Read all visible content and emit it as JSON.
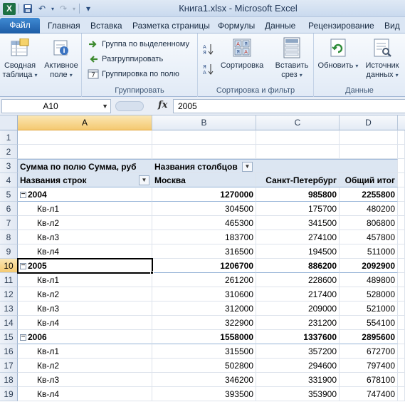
{
  "window": {
    "title": "Книга1.xlsx - Microsoft Excel",
    "logo_letter": "X"
  },
  "qat": {
    "icons": [
      "excel-logo",
      "save-icon",
      "undo-icon",
      "redo-icon",
      "customize-icon"
    ],
    "undo_glyph": "↶",
    "redo_glyph": "↷",
    "customize_glyph": "▾"
  },
  "tabs": {
    "file": "Файл",
    "items": [
      "Главная",
      "Вставка",
      "Разметка страницы",
      "Формулы",
      "Данные",
      "Рецензирование",
      "Вид"
    ],
    "active_index": null
  },
  "ribbon": {
    "pivot_table": {
      "line1": "Сводная",
      "line2": "таблица",
      "caret": "▾"
    },
    "active_field": {
      "line1": "Активное",
      "line2": "поле",
      "caret": "▾"
    },
    "group_selection": "Группа по выделенному",
    "ungroup": "Разгруппировать",
    "group_field": "Группировка по полю",
    "group_label_grouping": "Группировать",
    "sort_asc_label": "",
    "sort": "Сортировка",
    "insert_slicer": {
      "line1": "Вставить",
      "line2": "срез",
      "caret": "▾"
    },
    "group_label_sort": "Сортировка и фильтр",
    "refresh": {
      "line1": "Обновить",
      "caret": "▾"
    },
    "source": {
      "line1": "Источник",
      "line2": "данных",
      "caret": "▾"
    },
    "group_label_data": "Данные",
    "accent": "#2a6db8"
  },
  "formula_bar": {
    "name_box": "A10",
    "fx": "fx",
    "value": "2005"
  },
  "sheet": {
    "columns": [
      "A",
      "B",
      "C",
      "D"
    ],
    "selected_column": "A",
    "selected_row": "10",
    "pivot_header": {
      "sum_label": "Сумма по полю Сумма, руб",
      "col_labels": "Названия столбцов",
      "row_labels": "Названия строк",
      "moscow": "Москва",
      "spb": "Санкт-Петербург",
      "total": "Общий итог"
    },
    "rows": [
      {
        "n": "1",
        "a": "",
        "b": "",
        "c": "",
        "d": "",
        "type": "empty"
      },
      {
        "n": "2",
        "a": "",
        "b": "",
        "c": "",
        "d": "",
        "type": "empty"
      },
      {
        "n": "5",
        "a": "2004",
        "b": "1270000",
        "c": "985800",
        "d": "2255800",
        "type": "year"
      },
      {
        "n": "6",
        "a": "Кв-л1",
        "b": "304500",
        "c": "175700",
        "d": "480200",
        "type": "q"
      },
      {
        "n": "7",
        "a": "Кв-л2",
        "b": "465300",
        "c": "341500",
        "d": "806800",
        "type": "q"
      },
      {
        "n": "8",
        "a": "Кв-л3",
        "b": "183700",
        "c": "274100",
        "d": "457800",
        "type": "q"
      },
      {
        "n": "9",
        "a": "Кв-л4",
        "b": "316500",
        "c": "194500",
        "d": "511000",
        "type": "q"
      },
      {
        "n": "10",
        "a": "2005",
        "b": "1206700",
        "c": "886200",
        "d": "2092900",
        "type": "year"
      },
      {
        "n": "11",
        "a": "Кв-л1",
        "b": "261200",
        "c": "228600",
        "d": "489800",
        "type": "q"
      },
      {
        "n": "12",
        "a": "Кв-л2",
        "b": "310600",
        "c": "217400",
        "d": "528000",
        "type": "q"
      },
      {
        "n": "13",
        "a": "Кв-л3",
        "b": "312000",
        "c": "209000",
        "d": "521000",
        "type": "q"
      },
      {
        "n": "14",
        "a": "Кв-л4",
        "b": "322900",
        "c": "231200",
        "d": "554100",
        "type": "q"
      },
      {
        "n": "15",
        "a": "2006",
        "b": "1558000",
        "c": "1337600",
        "d": "2895600",
        "type": "year"
      },
      {
        "n": "16",
        "a": "Кв-л1",
        "b": "315500",
        "c": "357200",
        "d": "672700",
        "type": "q"
      },
      {
        "n": "17",
        "a": "Кв-л2",
        "b": "502800",
        "c": "294600",
        "d": "797400",
        "type": "q"
      },
      {
        "n": "18",
        "a": "Кв-л3",
        "b": "346200",
        "c": "331900",
        "d": "678100",
        "type": "q"
      },
      {
        "n": "19",
        "a": "Кв-л4",
        "b": "393500",
        "c": "353900",
        "d": "747400",
        "type": "q"
      }
    ],
    "header_row_numbers": [
      "3",
      "4"
    ]
  }
}
